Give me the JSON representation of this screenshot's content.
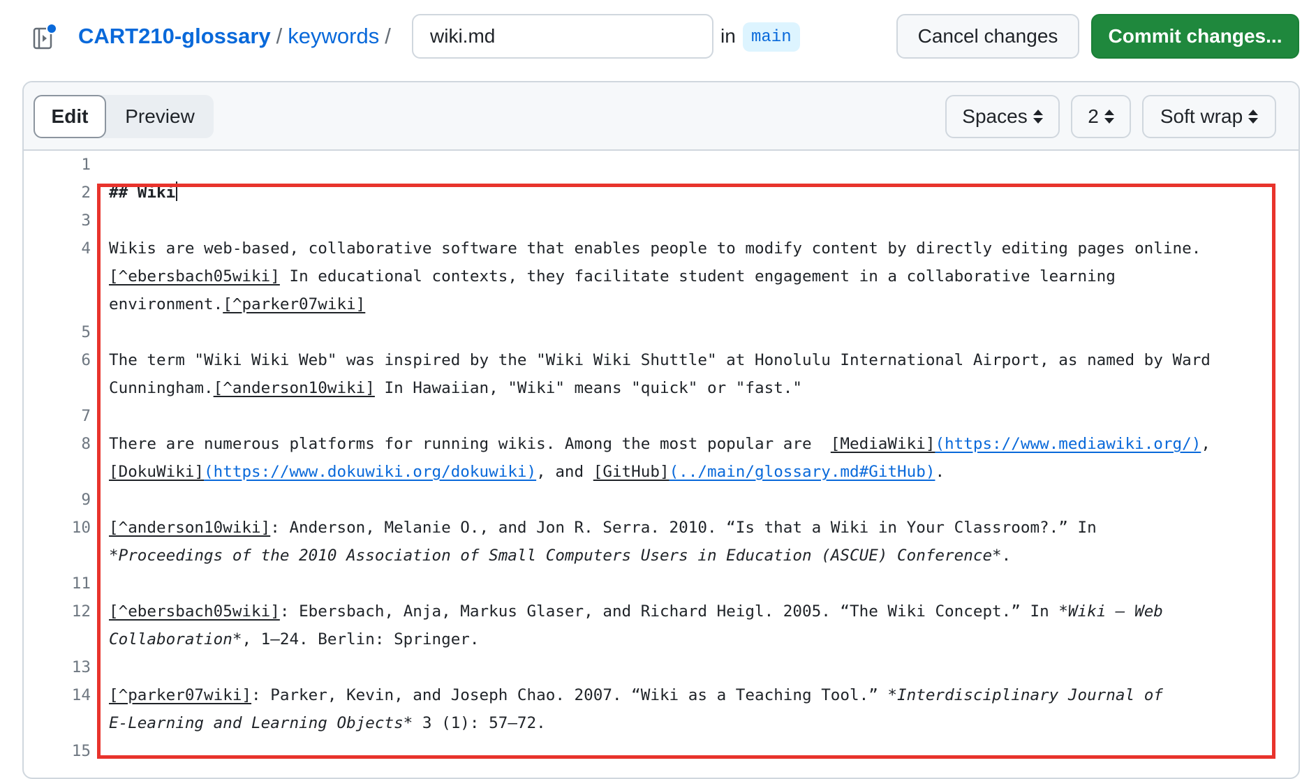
{
  "header": {
    "repo": "CART210-glossary",
    "sep1": "/",
    "folder": "keywords",
    "sep2": "/",
    "filename": "wiki.md",
    "in_label": "in",
    "branch": "main",
    "cancel_label": "Cancel changes",
    "commit_label": "Commit changes..."
  },
  "toolbar": {
    "tab_edit": "Edit",
    "tab_preview": "Preview",
    "indent_mode": "Spaces",
    "indent_size": "2",
    "wrap_mode": "Soft wrap"
  },
  "editor": {
    "line_numbers": [
      "1",
      "2",
      "3",
      "4",
      "5",
      "6",
      "7",
      "8",
      "9",
      "10",
      "11",
      "12",
      "13",
      "14",
      "15"
    ],
    "line2": "## Wiki",
    "line4a": "Wikis are web-based, collaborative software that enables people to modify content by directly editing pages online.",
    "line4b_ref": "[^ebersbach05wiki]",
    "line4b_text": " In educational contexts, they facilitate student engagement in a collaborative learning",
    "line4c_text": "environment.",
    "line4c_ref": "[^parker07wiki]",
    "line6a": "The term \"Wiki Wiki Web\" was inspired by the \"Wiki Wiki Shuttle\" at Honolulu International Airport, as named by Ward",
    "line6b_text": "Cunningham.",
    "line6b_ref": "[^anderson10wiki]",
    "line6b_rest": " In Hawaiian, \"Wiki\" means \"quick\" or \"fast.\"",
    "line8a_text": "There are numerous platforms for running wikis. Among the most popular are  ",
    "line8a_link1": "[MediaWiki]",
    "line8a_url1": "(https://www.mediawiki.org/)",
    "line8a_comma": ",",
    "line8b_link2": "[DokuWiki]",
    "line8b_url2": "(https://www.dokuwiki.org/dokuwiki)",
    "line8b_and": ", and ",
    "line8b_link3": "[GitHub]",
    "line8b_url3": "(../main/glossary.md#GitHub)",
    "line8b_end": ".",
    "line10_ref": "[^anderson10wiki]",
    "line10a": ": Anderson, Melanie O., and Jon R. Serra. 2010. “Is that a Wiki in Your Classroom?.” In",
    "line10b": "*Proceedings of the 2010 Association of Small Computers Users in Education (ASCUE) Conference*",
    "line10b_end": ".",
    "line12_ref": "[^ebersbach05wiki]",
    "line12a": ": Ebersbach, Anja, Markus Glaser, and Richard Heigl. 2005. “The Wiki Concept.” In ",
    "line12a_it": "*Wiki – Web",
    "line12b_it": "Collaboration*",
    "line12b": ", 1–24. Berlin: Springer.",
    "line14_ref": "[^parker07wiki]",
    "line14a": ": Parker, Kevin, and Joseph Chao. 2007. “Wiki as a Teaching Tool.” ",
    "line14a_it": "*Interdisciplinary Journal of",
    "line14b_it": "E-Learning and Learning Objects*",
    "line14b": " 3 (1): 57–72."
  },
  "colors": {
    "link": "#0969da",
    "commit": "#1f883d",
    "highlight": "#e8332c",
    "branch_bg": "#ddf4ff"
  },
  "icons": {
    "file": "file-editor-icon"
  }
}
